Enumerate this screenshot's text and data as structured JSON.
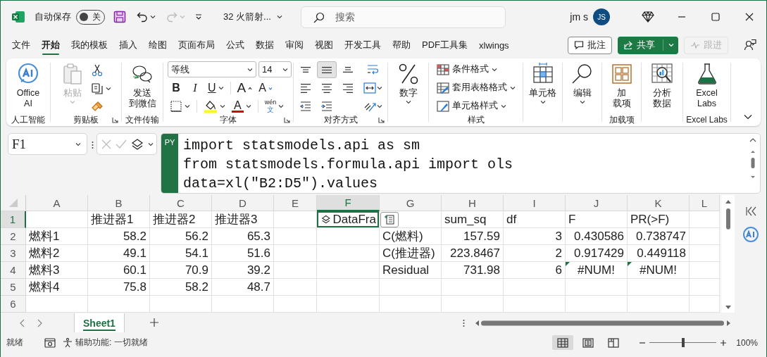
{
  "title_bar": {
    "autosave_label": "自动保存",
    "autosave_toggle": {
      "label": "关",
      "on": false
    },
    "file_name": "32 火箭射...",
    "search": {
      "placeholder": "搜索"
    },
    "user_name": "jm s",
    "avatar": "JS"
  },
  "tabs": [
    {
      "label": "文件",
      "selected": false
    },
    {
      "label": "开始",
      "selected": true
    },
    {
      "label": "我的模板",
      "selected": false
    },
    {
      "label": "插入",
      "selected": false
    },
    {
      "label": "绘图",
      "selected": false
    },
    {
      "label": "页面布局",
      "selected": false
    },
    {
      "label": "公式",
      "selected": false
    },
    {
      "label": "数据",
      "selected": false
    },
    {
      "label": "审阅",
      "selected": false
    },
    {
      "label": "视图",
      "selected": false
    },
    {
      "label": "开发工具",
      "selected": false
    },
    {
      "label": "帮助",
      "selected": false
    },
    {
      "label": "PDF工具集",
      "selected": false
    },
    {
      "label": "xlwings",
      "selected": false
    }
  ],
  "tab_actions": [
    {
      "label": "批注",
      "kind": "comments",
      "disabled": false
    },
    {
      "label": "共享",
      "kind": "share",
      "disabled": false
    },
    {
      "label": "跟进",
      "kind": "catch_up",
      "disabled": true
    }
  ],
  "ribbon": {
    "groups": [
      {
        "kind": "large",
        "label": "人工智能",
        "buttons": [
          {
            "lines": [
              "Office",
              "AI"
            ],
            "caret": false
          }
        ]
      },
      {
        "kind": "clipboard",
        "label": "剪贴板",
        "launcher": true,
        "paste": {
          "label": "粘贴",
          "disabled": true
        }
      },
      {
        "kind": "large",
        "label": "文件传输",
        "buttons": [
          {
            "lines": [
              "发送",
              "到微信"
            ],
            "caret": false
          }
        ]
      },
      {
        "kind": "font",
        "label": "字体",
        "launcher": true,
        "font_name": "等线",
        "font_size": "14",
        "bold": "B",
        "italic": "I",
        "underline": "U",
        "grow_font": "A",
        "shrink_font": "A",
        "font_color": "A",
        "phonetic": "wén",
        "phonetic_char": "文"
      },
      {
        "kind": "alignment",
        "label": "对齐方式",
        "launcher": true,
        "vertical": [
          {
            "selected": false
          },
          {
            "selected": true
          },
          {
            "selected": false
          }
        ],
        "horizontal": [
          {
            "selected": false
          },
          {
            "selected": false
          },
          {
            "selected": false
          }
        ]
      },
      {
        "kind": "large",
        "buttons": [
          {
            "lines": [
              "数字"
            ],
            "caret": true
          }
        ]
      },
      {
        "kind": "list",
        "label": "样式",
        "items": [
          {
            "label": "条件格式",
            "caret": true
          },
          {
            "label": "套用表格格式",
            "caret": true
          },
          {
            "label": "单元格样式",
            "caret": true
          }
        ]
      },
      {
        "kind": "large",
        "buttons": [
          {
            "lines": [
              "单元格"
            ],
            "caret": true
          }
        ]
      },
      {
        "kind": "large",
        "buttons": [
          {
            "lines": [
              "编辑"
            ],
            "caret": true
          }
        ]
      },
      {
        "kind": "large",
        "label": "加载项",
        "buttons": [
          {
            "lines": [
              "加",
              "载项"
            ],
            "caret": false
          }
        ]
      },
      {
        "kind": "large",
        "buttons": [
          {
            "lines": [
              "分析",
              "数据"
            ],
            "caret": false
          }
        ]
      },
      {
        "kind": "large",
        "label": "Excel Labs",
        "buttons": [
          {
            "lines": [
              "Excel",
              "Labs"
            ],
            "caret": false
          }
        ]
      }
    ]
  },
  "formula_bar": {
    "name_box": "F1",
    "badge": "PY",
    "code_lines": [
      "import statsmodels.api as sm",
      "from statsmodels.formula.api import ols",
      "data=xl(\"B2:D5\").values"
    ]
  },
  "grid": {
    "columns": [
      {
        "label": "A",
        "selected": false
      },
      {
        "label": "B",
        "selected": false
      },
      {
        "label": "C",
        "selected": false
      },
      {
        "label": "D",
        "selected": false
      },
      {
        "label": "E",
        "selected": false
      },
      {
        "label": "F",
        "selected": true
      },
      {
        "label": "G",
        "selected": false
      },
      {
        "label": "H",
        "selected": false
      },
      {
        "label": "I",
        "selected": false
      },
      {
        "label": "J",
        "selected": false
      },
      {
        "label": "K",
        "selected": false
      },
      {
        "label": "L",
        "selected": false
      }
    ],
    "rows": [
      {
        "label": "1",
        "selected": true,
        "cells": [
          {
            "kind": "empty",
            "selected": false
          },
          {
            "text": "推进器1",
            "kind": "text",
            "selected": false
          },
          {
            "text": "推进器2",
            "kind": "text",
            "selected": false
          },
          {
            "text": "推进器3",
            "kind": "text",
            "selected": false
          },
          {
            "kind": "empty",
            "selected": false
          },
          {
            "text": "DataFra",
            "kind": "python_object",
            "selected": true
          },
          {
            "kind": "empty",
            "selected": false
          },
          {
            "text": "sum_sq",
            "kind": "text",
            "selected": false
          },
          {
            "text": "df",
            "kind": "text",
            "selected": false
          },
          {
            "text": "F",
            "kind": "text",
            "selected": false
          },
          {
            "text": "PR(>F)",
            "kind": "text",
            "selected": false
          },
          {
            "kind": "empty",
            "selected": false
          }
        ]
      },
      {
        "label": "2",
        "selected": false,
        "cells": [
          {
            "text": "燃料1",
            "kind": "text",
            "selected": false
          },
          {
            "text": "58.2",
            "kind": "number",
            "selected": false
          },
          {
            "text": "56.2",
            "kind": "number",
            "selected": false
          },
          {
            "text": "65.3",
            "kind": "number",
            "selected": false
          },
          {
            "kind": "empty",
            "selected": false
          },
          {
            "kind": "empty",
            "selected": false
          },
          {
            "text": "C(燃料)",
            "kind": "text",
            "selected": false
          },
          {
            "text": "157.59",
            "kind": "number",
            "selected": false
          },
          {
            "text": "3",
            "kind": "number",
            "selected": false
          },
          {
            "text": "0.430586",
            "kind": "number",
            "selected": false
          },
          {
            "text": "0.738747",
            "kind": "number",
            "selected": false
          },
          {
            "kind": "empty",
            "selected": false
          }
        ]
      },
      {
        "label": "3",
        "selected": false,
        "cells": [
          {
            "text": "燃料2",
            "kind": "text",
            "selected": false
          },
          {
            "text": "49.1",
            "kind": "number",
            "selected": false
          },
          {
            "text": "54.1",
            "kind": "number",
            "selected": false
          },
          {
            "text": "51.6",
            "kind": "number",
            "selected": false
          },
          {
            "kind": "empty",
            "selected": false
          },
          {
            "kind": "empty",
            "selected": false
          },
          {
            "text": "C(推进器)",
            "kind": "text",
            "selected": false
          },
          {
            "text": "223.8467",
            "kind": "number",
            "selected": false
          },
          {
            "text": "2",
            "kind": "number",
            "selected": false
          },
          {
            "text": "0.917429",
            "kind": "number",
            "selected": false
          },
          {
            "text": "0.449118",
            "kind": "number",
            "selected": false
          },
          {
            "kind": "empty",
            "selected": false
          }
        ]
      },
      {
        "label": "4",
        "selected": false,
        "cells": [
          {
            "text": "燃料3",
            "kind": "text",
            "selected": false
          },
          {
            "text": "60.1",
            "kind": "number",
            "selected": false
          },
          {
            "text": "70.9",
            "kind": "number",
            "selected": false
          },
          {
            "text": "39.2",
            "kind": "number",
            "selected": false
          },
          {
            "kind": "empty",
            "selected": false
          },
          {
            "kind": "empty",
            "selected": false
          },
          {
            "text": "Residual",
            "kind": "text",
            "selected": false
          },
          {
            "text": "731.98",
            "kind": "number",
            "selected": false
          },
          {
            "text": "6",
            "kind": "number",
            "selected": false
          },
          {
            "text": "#NUM!",
            "kind": "error",
            "selected": false
          },
          {
            "text": "#NUM!",
            "kind": "error",
            "selected": false
          },
          {
            "kind": "empty",
            "selected": false
          }
        ]
      },
      {
        "label": "5",
        "selected": false,
        "cells": [
          {
            "text": "燃料4",
            "kind": "text",
            "selected": false
          },
          {
            "text": "75.8",
            "kind": "number",
            "selected": false
          },
          {
            "text": "58.2",
            "kind": "number",
            "selected": false
          },
          {
            "text": "48.7",
            "kind": "number",
            "selected": false
          },
          {
            "kind": "empty",
            "selected": false
          },
          {
            "kind": "empty",
            "selected": false
          },
          {
            "kind": "empty",
            "selected": false
          },
          {
            "kind": "empty",
            "selected": false
          },
          {
            "kind": "empty",
            "selected": false
          },
          {
            "kind": "empty",
            "selected": false
          },
          {
            "kind": "empty",
            "selected": false
          },
          {
            "kind": "empty",
            "selected": false
          }
        ]
      },
      {
        "label": "6",
        "selected": false,
        "cells": [
          {
            "kind": "empty",
            "selected": false
          },
          {
            "kind": "empty",
            "selected": false
          },
          {
            "kind": "empty",
            "selected": false
          },
          {
            "kind": "empty",
            "selected": false
          },
          {
            "kind": "empty",
            "selected": false
          },
          {
            "kind": "empty",
            "selected": false
          },
          {
            "kind": "empty",
            "selected": false
          },
          {
            "kind": "empty",
            "selected": false
          },
          {
            "kind": "empty",
            "selected": false
          },
          {
            "kind": "empty",
            "selected": false
          },
          {
            "kind": "empty",
            "selected": false
          },
          {
            "kind": "empty",
            "selected": false
          }
        ]
      }
    ]
  },
  "sheets": [
    {
      "label": "Sheet1",
      "selected": true
    }
  ],
  "status_bar": {
    "status": "就绪",
    "accessibility": "辅助功能: 一切就绪",
    "views": [
      {
        "selected": true
      },
      {
        "selected": false
      },
      {
        "selected": false
      }
    ],
    "zoom": {
      "level": 0.5,
      "reading": "100%"
    }
  }
}
